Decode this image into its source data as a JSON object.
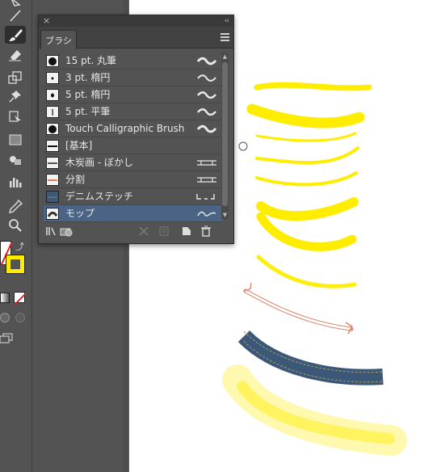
{
  "panel": {
    "tab_label": "ブラシ",
    "close_glyph": "×",
    "collapse_glyph": "‹‹"
  },
  "brushes": [
    {
      "name": "15 pt. 丸筆",
      "thumb": "dot-large"
    },
    {
      "name": "3 pt. 楕円",
      "thumb": "dot-small"
    },
    {
      "name": "5 pt. 楕円",
      "thumb": "dot-medium"
    },
    {
      "name": "5 pt. 平筆",
      "thumb": "flat"
    },
    {
      "name": "Touch Calligraphic Brush",
      "thumb": "dot-large"
    },
    {
      "name": "[基本]",
      "thumb": "basic"
    },
    {
      "name": "木炭画 - ぼかし",
      "thumb": "charcoal"
    },
    {
      "name": "分割",
      "thumb": "divide"
    },
    {
      "name": "デニムステッチ",
      "thumb": "denim"
    },
    {
      "name": "モップ",
      "thumb": "mop",
      "selected": true
    }
  ],
  "colors": {
    "stroke_yellow": "#ffed00",
    "selection_blue": "#4b6384",
    "artboard_edge_red": "#c8323c",
    "denim_blue": "#3b5878"
  },
  "icons": {
    "toolbar": [
      "direct-selection-icon",
      "line-icon",
      "paintbrush-icon",
      "eraser-icon",
      "scale-icon",
      "pin-icon",
      "free-transform-icon",
      "gradient-icon",
      "shape-builder-icon",
      "graph-icon",
      "eyedropper-icon",
      "zoom-icon"
    ],
    "panel_bottom": [
      "brush-libraries-icon",
      "brush-library-persist-icon",
      "remove-stroke-icon",
      "options-icon",
      "new-brush-icon",
      "delete-brush-icon"
    ]
  }
}
